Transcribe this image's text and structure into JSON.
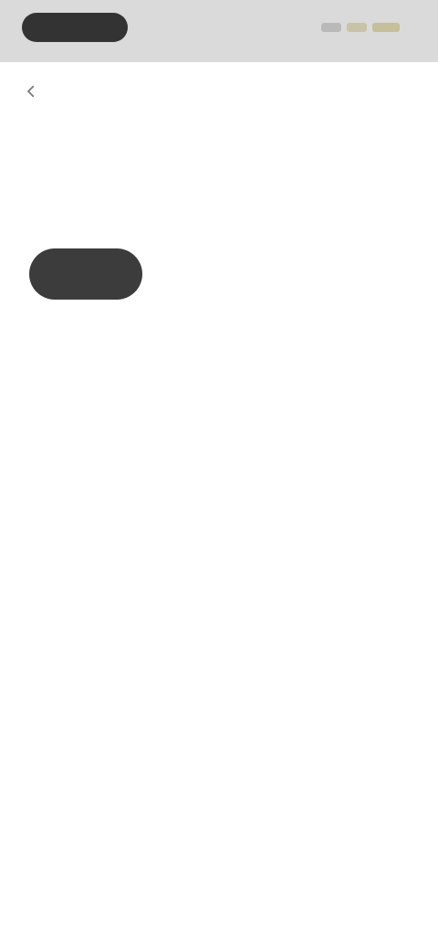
{
  "status_bar": {
    "time": "",
    "icons": [
      "signal-icon",
      "wifi-icon",
      "battery-icon"
    ]
  },
  "header": {
    "back_icon": "arrow-left-icon",
    "title": "",
    "subtitle": ""
  },
  "tabs": [
    {
      "label": "",
      "active": true
    },
    {
      "label": "",
      "active": false
    },
    {
      "label": "",
      "active": false
    }
  ],
  "section": {
    "caption": ""
  },
  "empty_state": {
    "title": "",
    "description": ""
  },
  "colors": {
    "status_bar_bg": "#dadada",
    "active_tab_bg": "#3c3c3c",
    "page_bg": "#ffffff"
  }
}
